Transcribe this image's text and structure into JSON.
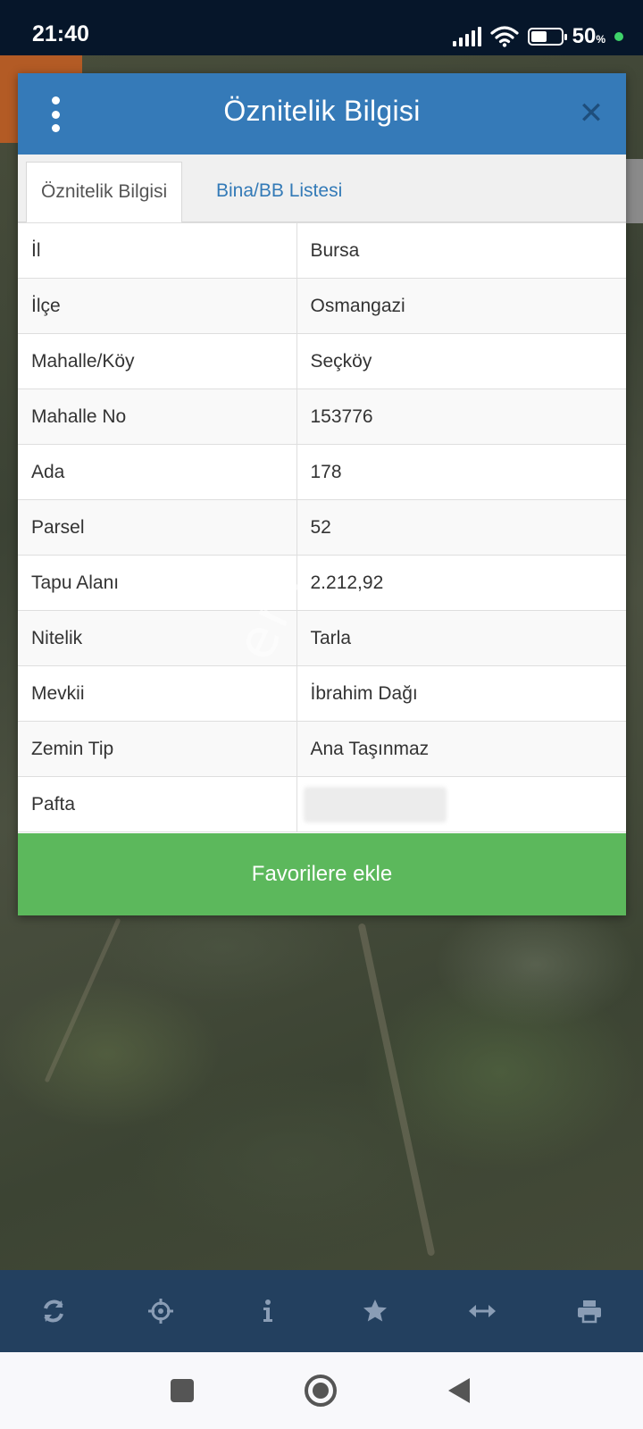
{
  "status_bar": {
    "time": "21:40",
    "battery_percent": "50",
    "battery_unit": "%"
  },
  "modal": {
    "title": "Öznitelik Bilgisi",
    "tabs": [
      {
        "label": "Öznitelik Bilgisi",
        "active": true
      },
      {
        "label": "Bina/BB Listesi",
        "active": false
      }
    ],
    "rows": [
      {
        "key": "İl",
        "value": "Bursa"
      },
      {
        "key": "İlçe",
        "value": "Osmangazi"
      },
      {
        "key": "Mahalle/Köy",
        "value": "Seçköy"
      },
      {
        "key": "Mahalle No",
        "value": "153776"
      },
      {
        "key": "Ada",
        "value": "178"
      },
      {
        "key": "Parsel",
        "value": "52"
      },
      {
        "key": "Tapu Alanı",
        "value": "2.212,92"
      },
      {
        "key": "Nitelik",
        "value": "Tarla"
      },
      {
        "key": "Mevkii",
        "value": "İbrahim Dağı"
      },
      {
        "key": "Zemin Tip",
        "value": "Ana Taşınmaz"
      },
      {
        "key": "Pafta",
        "value": ""
      }
    ],
    "favorite_button": "Favorilere ekle"
  },
  "toolbar": {
    "icons": [
      "refresh-icon",
      "locate-icon",
      "info-icon",
      "star-icon",
      "measure-icon",
      "print-icon"
    ]
  },
  "colors": {
    "header_blue": "#357ab8",
    "tab_link": "#337ab7",
    "button_green": "#5cb85c",
    "toolbar_bg": "#23405f",
    "toolbar_icon": "#8a9db5",
    "status_bg": "#06162a"
  }
}
